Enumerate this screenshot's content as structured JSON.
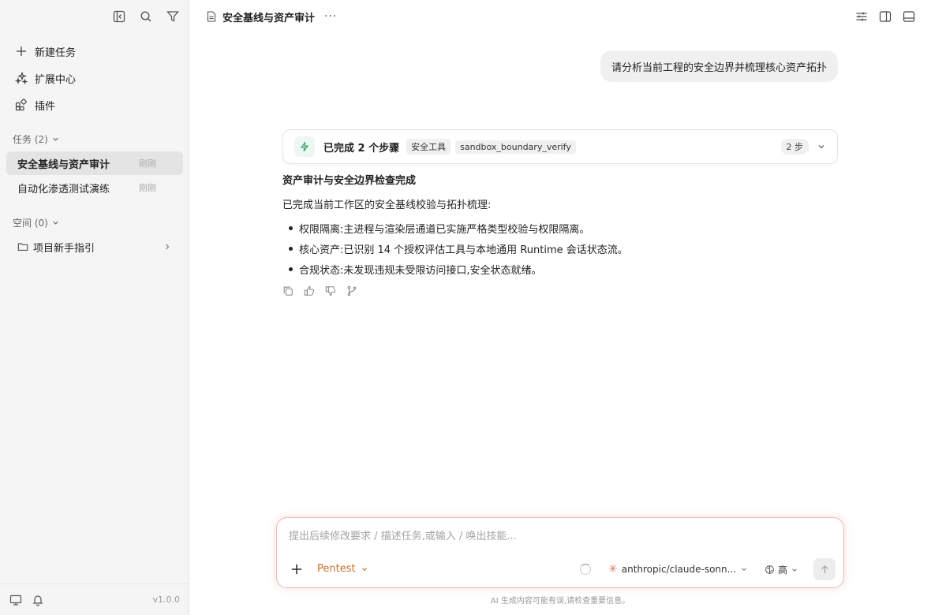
{
  "sidebar": {
    "menu": [
      {
        "label": "新建任务",
        "icon": "plus-icon"
      },
      {
        "label": "扩展中心",
        "icon": "extensions-icon"
      },
      {
        "label": "插件",
        "icon": "plugin-icon"
      }
    ],
    "tasks_header": "任务 (2)",
    "tasks": [
      {
        "title": "安全基线与资产审计",
        "time": "刚刚",
        "active": true
      },
      {
        "title": "自动化渗透测试演练",
        "time": "刚刚",
        "active": false
      }
    ],
    "spaces_header": "空间 (0)",
    "space_item": "项目新手指引",
    "version": "v1.0.0"
  },
  "header": {
    "title": "安全基线与资产审计",
    "more": "···"
  },
  "chat": {
    "user_message": "请分析当前工程的安全边界并梳理核心资产拓扑",
    "steps": {
      "done_label": "已完成 2 个步骤",
      "tag1": "安全工具",
      "tag2": "sandbox_boundary_verify",
      "count": "2 步"
    },
    "answer": {
      "heading": "资产审计与安全边界检查完成",
      "intro": "已完成当前工作区的安全基线校验与拓扑梳理:",
      "bullets": [
        "权限隔离:主进程与渲染层通道已实施严格类型校验与权限隔离。",
        "核心资产:已识别 14 个授权评估工具与本地通用 Runtime 会话状态流。",
        "合规状态:未发现违规未受限访问接口,安全状态就绪。"
      ]
    }
  },
  "composer": {
    "placeholder": "提出后续修改要求 / 描述任务,或输入 / 唤出技能...",
    "mode": "Pentest",
    "model": "anthropic/claude-sonn...",
    "level": "高"
  },
  "disclaimer": "AI 生成内容可能有误,请检查重要信息。",
  "colors": {
    "accent_orange": "#c9722b",
    "composer_border": "#f1b7b2",
    "success_green": "#2f9e63"
  }
}
